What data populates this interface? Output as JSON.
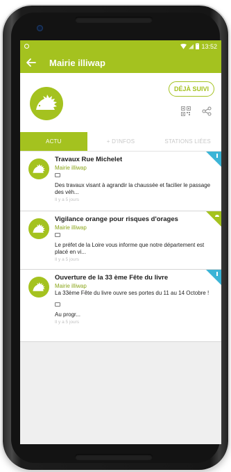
{
  "statusbar": {
    "time": "13:52"
  },
  "appbar": {
    "title": "Mairie illiwap"
  },
  "profile": {
    "follow_label": "DÉJÀ SUIVI"
  },
  "tabs": [
    {
      "label": "ACTU",
      "active": true
    },
    {
      "label": "+ D'INFOS",
      "active": false
    },
    {
      "label": "STATIONS LIÉES",
      "active": false
    }
  ],
  "feed": [
    {
      "title": "Travaux Rue Michelet",
      "source": "Mairie illiwap",
      "body": "Des travaux visant à agrandir la chaussée et facilier le passage des véh...",
      "time": "Il y a 5 jours",
      "corner_color": "#3bb4d6"
    },
    {
      "title": "Vigilance orange pour risques d'orages",
      "source": "Mairie illiwap",
      "body": "Le préfet de la Loire vous informe que notre département est placé en vi...",
      "time": "Il y a 5 jours",
      "corner_color": "#a4c21f"
    },
    {
      "title": "Ouverture de la 33 ème Fête du livre",
      "source": "Mairie illiwap",
      "intro": "La 33ème Fête du livre ouvre ses portes du 11 au 14 Octobre !",
      "body": "Au progr...",
      "time": "Il y a 5 jours",
      "corner_color": "#3bb4d6"
    }
  ],
  "colors": {
    "brand": "#a4c21f",
    "info": "#3bb4d6"
  }
}
